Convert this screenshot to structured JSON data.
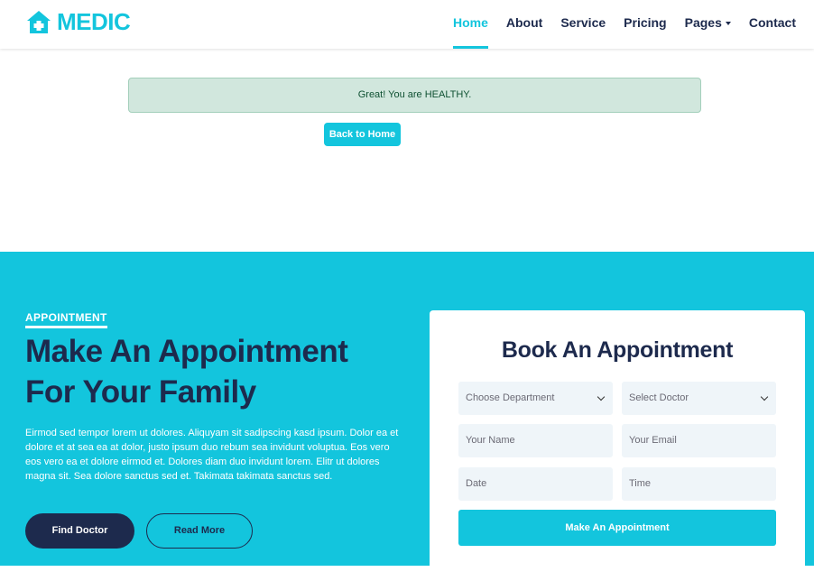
{
  "brand": {
    "name": "MEDIC",
    "logo_icon": "hospital-icon",
    "color": "#13C5DD"
  },
  "nav": {
    "items": [
      {
        "label": "Home",
        "active": true
      },
      {
        "label": "About"
      },
      {
        "label": "Service"
      },
      {
        "label": "Pricing"
      },
      {
        "label": "Pages",
        "dropdown": true
      },
      {
        "label": "Contact"
      }
    ]
  },
  "alert": {
    "message": "Great! You are HEALTHY.",
    "color": "#d1e7dd"
  },
  "back_button": {
    "label": "Back to Home"
  },
  "appointment": {
    "eyebrow": "APPOINTMENT",
    "heading": "Make An Appointment For Your Family",
    "paragraph": "Eirmod sed tempor lorem ut dolores. Aliquyam sit sadipscing kasd ipsum. Dolor ea et dolore et at sea ea at dolor, justo ipsum duo rebum sea invidunt voluptua. Eos vero eos vero ea et dolore eirmod et. Dolores diam duo invidunt lorem. Elitr ut dolores magna sit. Sea dolore sanctus sed et. Takimata takimata sanctus sed.",
    "find_doctor_label": "Find Doctor",
    "read_more_label": "Read More",
    "background": "#13C5DD",
    "dark": "#1D2A4D"
  },
  "form": {
    "title": "Book An Appointment",
    "department_placeholder": "Choose Department",
    "doctor_placeholder": "Select Doctor",
    "name_placeholder": "Your Name",
    "email_placeholder": "Your Email",
    "date_placeholder": "Date",
    "time_placeholder": "Time",
    "submit_label": "Make An Appointment"
  }
}
